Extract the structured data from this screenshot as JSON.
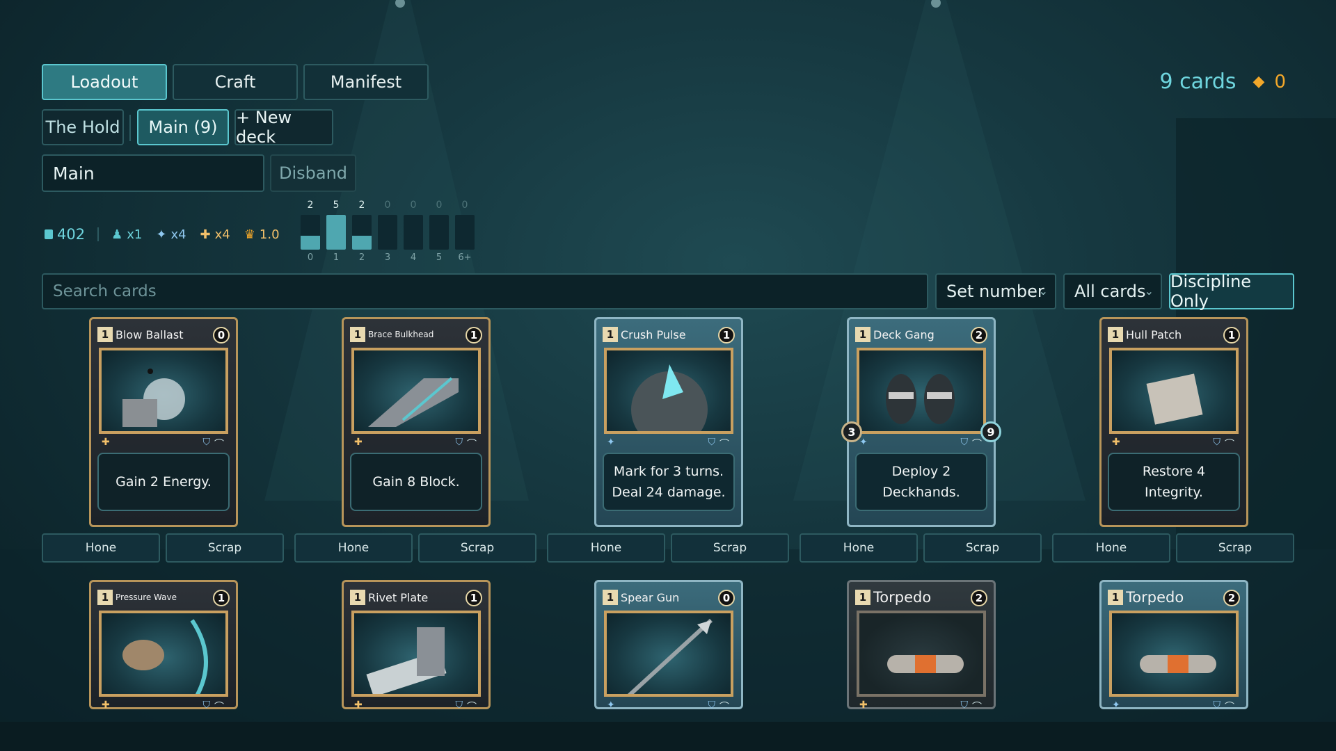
{
  "tabs": [
    {
      "label": "Loadout",
      "active": true
    },
    {
      "label": "Craft",
      "active": false
    },
    {
      "label": "Manifest",
      "active": false
    }
  ],
  "summary": {
    "card_count": "9 cards",
    "currency": "0"
  },
  "decks": {
    "hold_label": "The Hold",
    "main_label": "Main (9)",
    "new_deck_label": "+ New deck"
  },
  "deck_name": {
    "value": "Main",
    "disband_label": "Disband"
  },
  "stats": {
    "total": "402",
    "deckhand": "x1",
    "spark": "x4",
    "heal": "x4",
    "crown": "1.0"
  },
  "curve": {
    "labels": [
      "0",
      "1",
      "2",
      "3",
      "4",
      "5",
      "6+"
    ],
    "counts": [
      2,
      5,
      2,
      0,
      0,
      0,
      0
    ]
  },
  "filters": {
    "search_placeholder": "Search cards",
    "sort_value": "Set number",
    "scope_value": "All cards",
    "discipline_label": "Discipline Only"
  },
  "actions": {
    "hone": "Hone",
    "scrap": "Scrap"
  },
  "cards": [
    {
      "name": "Blow Ballast",
      "cost": "1",
      "gem": "0",
      "text": "Gain 2 Energy.",
      "style": "gold",
      "size": "normal",
      "art": "ballast"
    },
    {
      "name": "Brace Bulkhead",
      "cost": "1",
      "gem": "1",
      "text": "Gain 8 Block.",
      "style": "gold",
      "size": "small",
      "art": "bulkhead"
    },
    {
      "name": "Crush Pulse",
      "cost": "1",
      "gem": "1",
      "text": "Mark for 3 turns.\nDeal 24 damage.",
      "style": "blue",
      "size": "normal",
      "art": "pulse"
    },
    {
      "name": "Deck Gang",
      "cost": "1",
      "gem": "2",
      "text": "Deploy 2\nDeckhands.",
      "style": "blue",
      "size": "normal",
      "art": "gang",
      "attack": "3",
      "health": "9"
    },
    {
      "name": "Hull Patch",
      "cost": "1",
      "gem": "1",
      "text": "Restore 4\nIntegrity.",
      "style": "gold",
      "size": "normal",
      "art": "patch"
    },
    {
      "name": "Pressure Wave",
      "cost": "1",
      "gem": "1",
      "style": "gold",
      "size": "small",
      "art": "wave"
    },
    {
      "name": "Rivet Plate",
      "cost": "1",
      "gem": "1",
      "style": "gold",
      "size": "normal",
      "art": "rivet"
    },
    {
      "name": "Spear Gun",
      "cost": "1",
      "gem": "0",
      "style": "blue",
      "size": "normal",
      "art": "spear"
    },
    {
      "name": "Torpedo",
      "cost": "1",
      "gem": "2",
      "style": "gray",
      "size": "big",
      "art": "torpedo"
    },
    {
      "name": "Torpedo",
      "cost": "1",
      "gem": "2",
      "style": "blue",
      "size": "big",
      "art": "torpedo"
    }
  ],
  "colors": {
    "accent": "#5bc7cf",
    "gold": "#f2a72a",
    "bg": "#163840"
  }
}
